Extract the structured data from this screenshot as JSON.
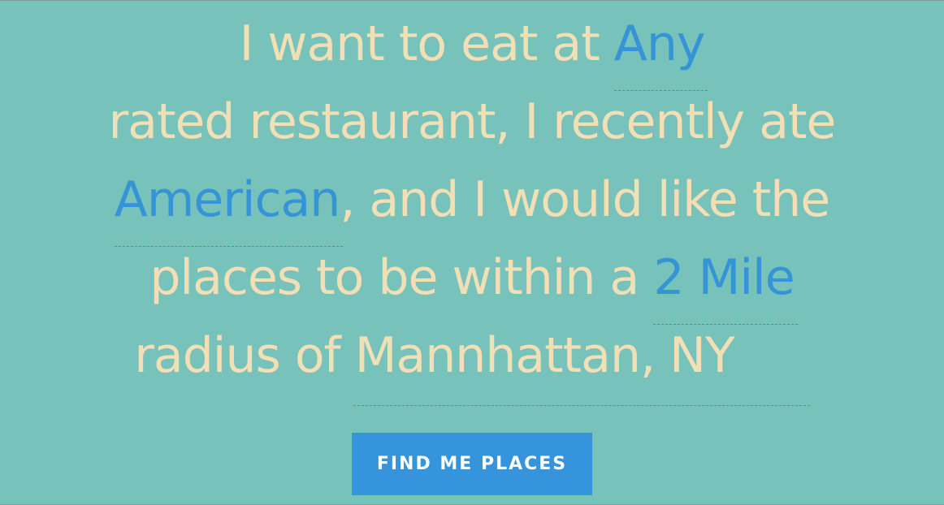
{
  "sentence": {
    "line1_prefix": "I want to eat at ",
    "rating_value": "Any",
    "line2_text": "rated restaurant, I recently ate",
    "cuisine_value": "American",
    "line3_suffix": ", and I would like the",
    "line4_prefix": "places to be within a ",
    "radius_value": "2 Mile",
    "line5_prefix": "radius of ",
    "location_value": "Mannhattan, NY"
  },
  "button": {
    "label": "FIND ME PLACES"
  },
  "colors": {
    "background": "#77c2bb",
    "text": "#f3dfb5",
    "accent": "#3594d6",
    "underline": "#c9605a",
    "button": "#3594db"
  }
}
